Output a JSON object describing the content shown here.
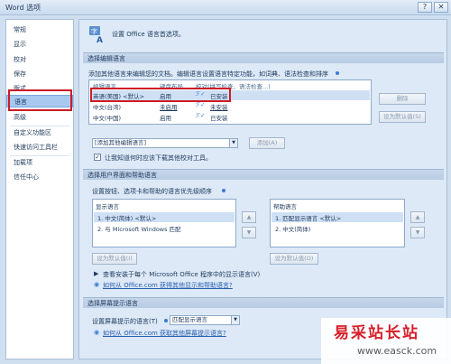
{
  "window": {
    "title": "Word 选项",
    "help_btn": "?",
    "close_btn": "✕"
  },
  "sidebar": {
    "items": [
      {
        "label": "常规"
      },
      {
        "label": "显示"
      },
      {
        "label": "校对"
      },
      {
        "label": "保存"
      },
      {
        "label": "版式"
      },
      {
        "label": "语言"
      },
      {
        "label": "高级"
      },
      {
        "label": "自定义功能区"
      },
      {
        "label": "快速访问工具栏"
      },
      {
        "label": "加载项"
      },
      {
        "label": "信任中心"
      }
    ]
  },
  "header": {
    "text": "设置 Office 语言首选项。"
  },
  "editing": {
    "section_title": "选择编辑语言",
    "description": "添加其他语言来编辑您的文档。编辑语言设置语言特定功能，如词典、语法检查和排序",
    "columns": [
      "编辑语言",
      "键盘布局",
      "校对(拼写检查、语法检查...)"
    ],
    "rows": [
      {
        "language": "英语(美国) <默认>",
        "keyboard": "启用",
        "proofing": "已安装"
      },
      {
        "language": "中文(台湾)",
        "keyboard": "未启用",
        "proofing": "未安装"
      },
      {
        "language": "中文(中国)",
        "keyboard": "启用",
        "proofing": "已安装"
      }
    ],
    "delete_btn": "删除",
    "set_default_btn": "设为默认值(S)",
    "add_combo": "[添加其他编辑语言]",
    "add_btn": "添加(A)",
    "checkbox_label": "让我知道何时应该下载其他校对工具。",
    "checkbox_checked": true
  },
  "ui_help": {
    "section_title": "选择用户界面和帮助语言",
    "description": "设置按钮、选项卡和帮助的语言优先级顺序",
    "display": {
      "header": "显示语言",
      "items": [
        "1.    中文(简体) <默认>",
        "2.    与 Microsoft Windows 匹配"
      ],
      "set_default_btn": "设为默认值(I)"
    },
    "help": {
      "header": "帮助语言",
      "items": [
        "1.    匹配显示语言 <默认>",
        "2.    中文(简体)"
      ],
      "set_default_btn": "设为默认值(O)"
    },
    "view_note": "查看安装于每个 Microsoft Office 程序中的显示语言(V)",
    "link": "如何从 Office.com 获得其他显示和帮助语言?"
  },
  "screentip": {
    "section_title": "选择屏幕提示语言",
    "label": "设置屏幕提示的语言(T)",
    "value": "匹配显示语言",
    "link": "如何从 Office.com 获取其他屏幕提示语言?"
  },
  "watermark": {
    "line1": "易采站长站",
    "line2": "www.easck.com"
  },
  "colors": {
    "highlight_red": "#cc1b26",
    "selected_nav": "#a8c8f0",
    "link": "#2a5db0"
  }
}
